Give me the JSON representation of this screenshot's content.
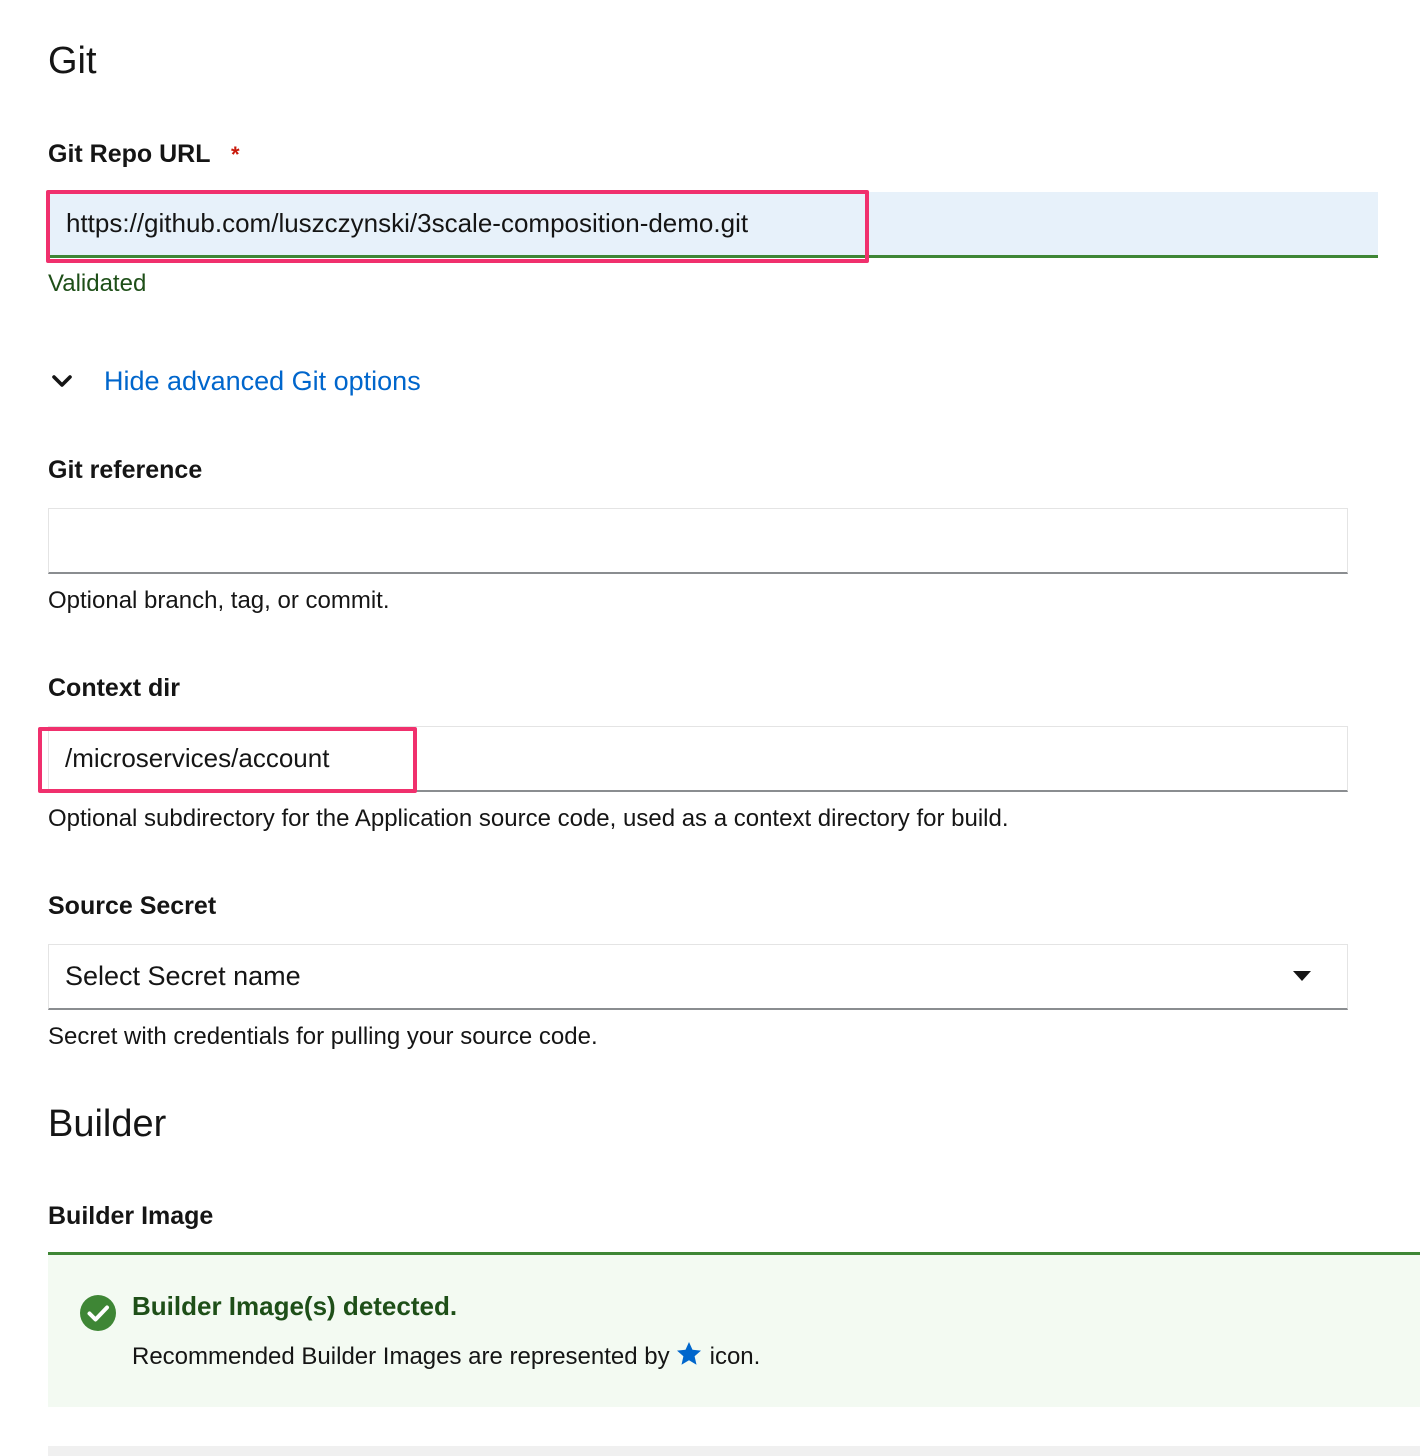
{
  "git_section": {
    "heading": "Git",
    "repo_url": {
      "label": "Git Repo URL",
      "required_mark": "*",
      "value": "https://github.com/luszczynski/3scale-composition-demo.git",
      "status": "Validated"
    },
    "advanced_toggle": {
      "label": "Hide advanced Git options",
      "icon": "chevron-down-icon",
      "expanded": true
    },
    "git_reference": {
      "label": "Git reference",
      "value": "",
      "helper": "Optional branch, tag, or commit."
    },
    "context_dir": {
      "label": "Context dir",
      "value": "/microservices/account",
      "helper": "Optional subdirectory for the Application source code, used as a context directory for build."
    },
    "source_secret": {
      "label": "Source Secret",
      "selected": "Select Secret name",
      "icon": "caret-down-icon",
      "helper": "Secret with credentials for pulling your source code."
    }
  },
  "builder_section": {
    "heading": "Builder",
    "builder_image": {
      "label": "Builder Image"
    },
    "alert": {
      "icon": "check-circle-icon",
      "title": "Builder Image(s) detected.",
      "body_before": "Recommended Builder Images are represented by",
      "body_icon": "star-icon",
      "body_after": "icon."
    }
  },
  "colors": {
    "highlight": "#f0306d",
    "success": "#3e8635",
    "link": "#0066cc",
    "required": "#c9190b"
  }
}
